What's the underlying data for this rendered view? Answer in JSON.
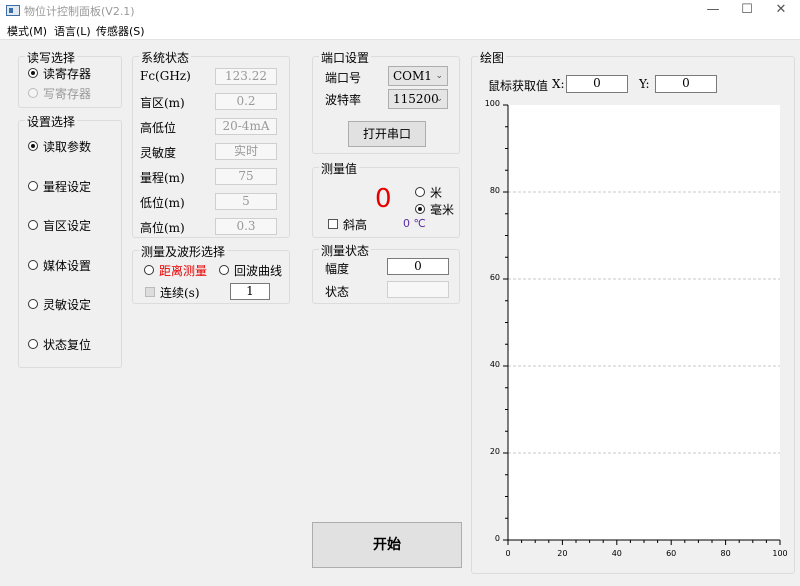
{
  "window": {
    "title": "物位计控制面板(V2.1)",
    "minimize": "—",
    "maximize": "☐",
    "close": "✕"
  },
  "menu": [
    "模式(M)",
    "语言(L)",
    "传感器(S)"
  ],
  "rw_group": {
    "title": "读写选择",
    "options": [
      {
        "label": "读寄存器",
        "checked": true,
        "disabled": false
      },
      {
        "label": "写寄存器",
        "checked": false,
        "disabled": true
      }
    ]
  },
  "settings_group": {
    "title": "设置选择",
    "options": [
      {
        "label": "读取参数",
        "checked": true
      },
      {
        "label": "量程设定",
        "checked": false
      },
      {
        "label": "盲区设定",
        "checked": false
      },
      {
        "label": "媒体设置",
        "checked": false
      },
      {
        "label": "灵敏设定",
        "checked": false
      },
      {
        "label": "状态复位",
        "checked": false
      }
    ]
  },
  "system_status": {
    "title": "系统状态",
    "rows": [
      {
        "label": "Fc(GHz)",
        "value": "123.22"
      },
      {
        "label": "盲区(m)",
        "value": "0.2"
      },
      {
        "label": "高低位",
        "value": "20-4mA"
      },
      {
        "label": "灵敏度",
        "value": "实时"
      },
      {
        "label": "量程(m)",
        "value": "75"
      },
      {
        "label": "低位(m)",
        "value": "5"
      },
      {
        "label": "高位(m)",
        "value": "0.3"
      }
    ]
  },
  "measure_mode": {
    "title": "测量及波形选择",
    "distance_label": "距离测量",
    "echo_label": "回波曲线",
    "continuous_label": "连续(s)",
    "continuous_value": "1",
    "accent": "#e60000"
  },
  "port": {
    "title": "端口设置",
    "port_label": "端口号",
    "port_value": "COM1",
    "baud_label": "波特率",
    "baud_value": "115200",
    "open_button": "打开串口"
  },
  "measured": {
    "title": "测量值",
    "value": "0",
    "value_color": "#e60000",
    "unit_m": "米",
    "unit_mm": "毫米",
    "tilt_label": "斜高",
    "temperature": "0 ℃",
    "temperature_color": "#5b2fa0"
  },
  "measure_state": {
    "title": "测量状态",
    "amplitude_label": "幅度",
    "amplitude_value": "0",
    "state_label": "状态",
    "state_value": ""
  },
  "start_button": "开始",
  "plot": {
    "title": "绘图",
    "cursor_label": "鼠标获取值",
    "x_label": "X:",
    "x_value": "0",
    "y_label": "Y:",
    "y_value": "0"
  },
  "chart_data": {
    "type": "line",
    "series": [],
    "xlim": [
      0,
      100
    ],
    "ylim": [
      0,
      100
    ],
    "x_ticks": [
      "0",
      "20",
      "40",
      "60",
      "80",
      "100"
    ],
    "y_ticks": [
      "0",
      "20",
      "40",
      "60",
      "80",
      "100"
    ],
    "grid": "horizontal dashed"
  }
}
